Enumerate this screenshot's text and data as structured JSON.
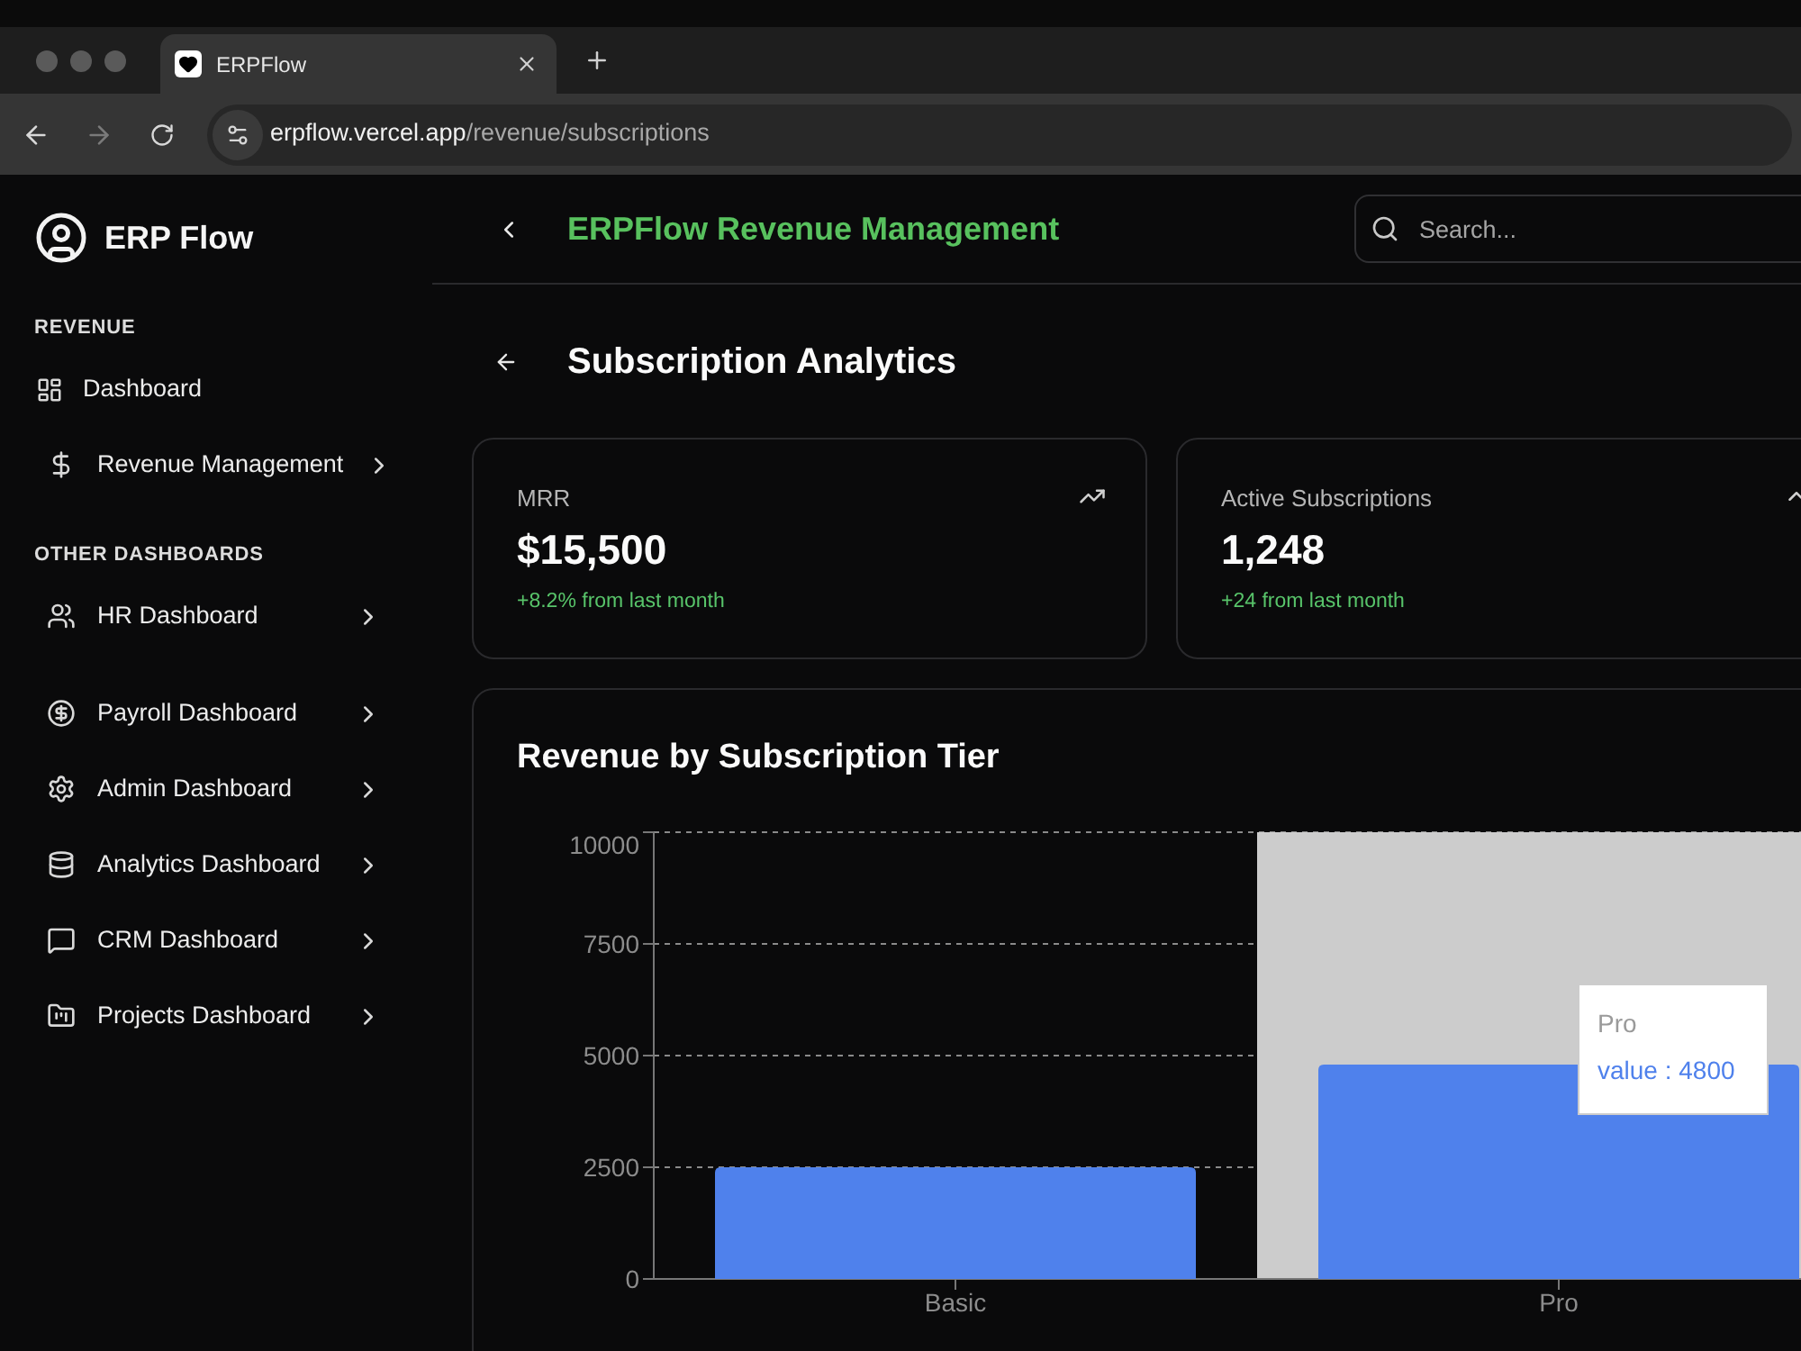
{
  "browser": {
    "tab": {
      "title": "ERPFlow"
    },
    "forward": {
      "disabled": true
    },
    "url": {
      "host": "erpflow.vercel.app",
      "path": "/revenue/subscriptions"
    }
  },
  "sidebar": {
    "brand": "ERP Flow",
    "sections": [
      {
        "label": "REVENUE",
        "items": [
          {
            "label": "Dashboard",
            "kind": "link"
          },
          {
            "label": "Revenue Management",
            "kind": "menu"
          }
        ]
      },
      {
        "label": "OTHER DASHBOARDS",
        "items": [
          {
            "label": "HR Dashboard",
            "kind": "menu"
          },
          {
            "label": "Payroll Dashboard",
            "kind": "menu"
          },
          {
            "label": "Admin Dashboard",
            "kind": "menu"
          },
          {
            "label": "Analytics Dashboard",
            "kind": "menu"
          },
          {
            "label": "CRM Dashboard",
            "kind": "menu"
          },
          {
            "label": "Projects Dashboard",
            "kind": "menu"
          }
        ]
      }
    ]
  },
  "header": {
    "title": "ERPFlow Revenue Management",
    "search": {
      "placeholder": "Search..."
    }
  },
  "page": {
    "title": "Subscription Analytics"
  },
  "stats": [
    {
      "label": "MRR",
      "value": "$15,500",
      "change": "+8.2% from last month"
    },
    {
      "label": "Active Subscriptions",
      "value": "1,248",
      "change": "+24 from last month"
    }
  ],
  "revenue_chart": {
    "chart_data": {
      "type": "bar",
      "title": "Revenue by Subscription Tier",
      "categories": [
        "Basic",
        "Pro"
      ],
      "values": [
        2500,
        4800
      ],
      "color": "#4f81ec",
      "ylim": [
        0,
        10000
      ],
      "yticks": [
        0,
        2500,
        5000,
        7500,
        10000
      ],
      "grid": true,
      "bands": [
        {
          "axis": "x",
          "from": "Pro",
          "to": "Pro",
          "color": "#cccccc"
        }
      ]
    },
    "tooltip": {
      "title": "Pro",
      "value": "value : 4800"
    }
  }
}
